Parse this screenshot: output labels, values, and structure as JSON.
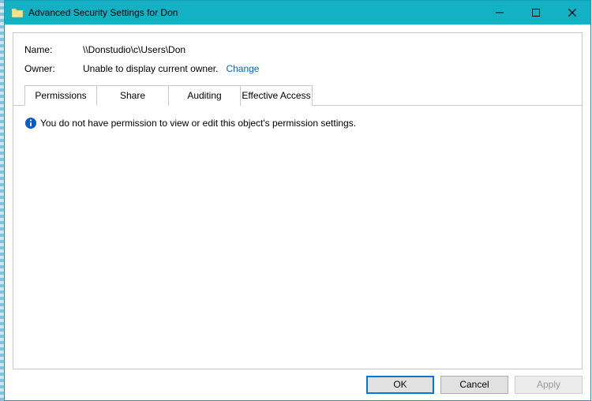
{
  "window": {
    "title": "Advanced Security Settings for Don"
  },
  "info": {
    "name_label": "Name:",
    "name_value": "\\\\Donstudio\\c\\Users\\Don",
    "owner_label": "Owner:",
    "owner_value": "Unable to display current owner.",
    "change_label": "Change"
  },
  "tabs": {
    "permissions": "Permissions",
    "share": "Share",
    "auditing": "Auditing",
    "effective": "Effective Access"
  },
  "message": "You do not have permission to view or edit this object's permission settings.",
  "buttons": {
    "ok": "OK",
    "cancel": "Cancel",
    "apply": "Apply"
  }
}
